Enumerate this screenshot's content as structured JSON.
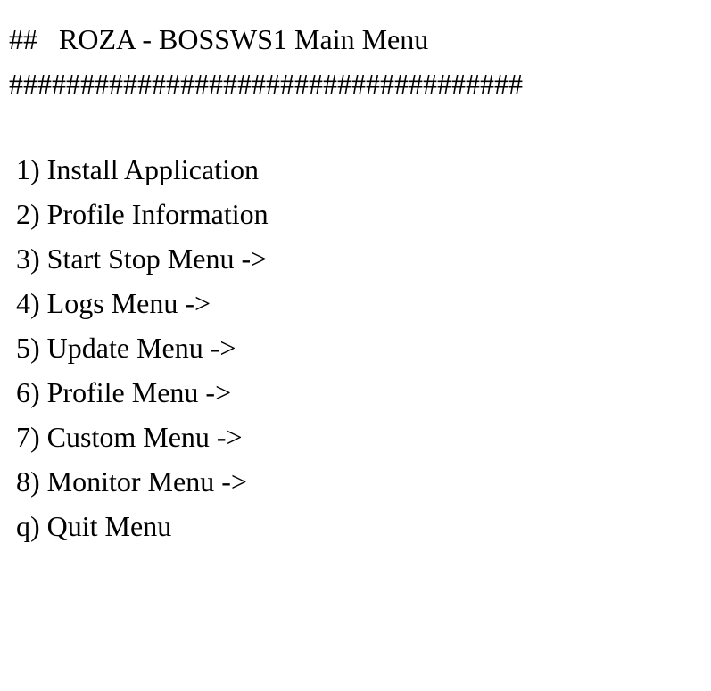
{
  "header": {
    "prefix": "##",
    "title": "ROZA - BOSSWS1   Main Menu",
    "divider": "####################################"
  },
  "menu": {
    "items": [
      {
        "key": "1",
        "label": "Install Application"
      },
      {
        "key": "2",
        "label": "Profile Information"
      },
      {
        "key": "3",
        "label": "Start Stop Menu ->"
      },
      {
        "key": "4",
        "label": "Logs Menu ->"
      },
      {
        "key": "5",
        "label": "Update Menu ->"
      },
      {
        "key": "6",
        "label": "Profile Menu ->"
      },
      {
        "key": "7",
        "label": "Custom Menu ->"
      },
      {
        "key": "8",
        "label": "Monitor Menu ->"
      },
      {
        "key": "q",
        "label": "Quit Menu"
      }
    ]
  }
}
